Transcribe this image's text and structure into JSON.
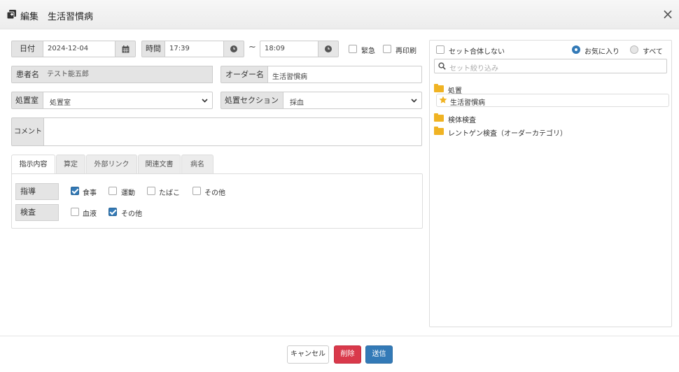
{
  "dialog": {
    "title": "編集　生活習慣病"
  },
  "form": {
    "date_label": "日付",
    "date_value": "2024-12-04",
    "time_label": "時間",
    "time_from": "17:39",
    "time_sep": "~",
    "time_to": "18:09",
    "urgent_label": "緊急",
    "reprint_label": "再印刷",
    "patient_label": "患者名",
    "patient_value": "テスト能五郎",
    "order_label": "オーダー名",
    "order_value": "生活習慣病",
    "room_label": "処置室",
    "room_value": "処置室",
    "section_label": "処置セクション",
    "section_value": "採血",
    "comment_label": "コメント",
    "comment_value": ""
  },
  "tabs": [
    {
      "label": "指示内容",
      "active": true
    },
    {
      "label": "算定",
      "active": false
    },
    {
      "label": "外部リンク",
      "active": false
    },
    {
      "label": "関連文書",
      "active": false
    },
    {
      "label": "病名",
      "active": false
    }
  ],
  "instructions": {
    "guidance_label": "指導",
    "guidance_items": [
      {
        "label": "食事",
        "checked": true
      },
      {
        "label": "運動",
        "checked": false
      },
      {
        "label": "たばこ",
        "checked": false
      },
      {
        "label": "その他",
        "checked": false
      }
    ],
    "test_label": "検査",
    "test_items": [
      {
        "label": "血液",
        "checked": false
      },
      {
        "label": "その他",
        "checked": true
      }
    ]
  },
  "sets": {
    "no_merge_label": "セット合体しない",
    "favorite_label": "お気に入り",
    "all_label": "すべて",
    "filter_placeholder": "セット絞り込み",
    "tree": {
      "folder1": "処置",
      "folder1_item": "生活習慣病",
      "folder2": "検体検査",
      "folder3": "レントゲン検査（オーダーカテゴリ）"
    }
  },
  "footer": {
    "cancel_label": "キャンセル",
    "delete_label": "削除",
    "send_label": "送信"
  },
  "colors": {
    "primary": "#337ab7",
    "danger": "#d9394b",
    "folder": "#f0b323",
    "star": "#f0b323"
  }
}
